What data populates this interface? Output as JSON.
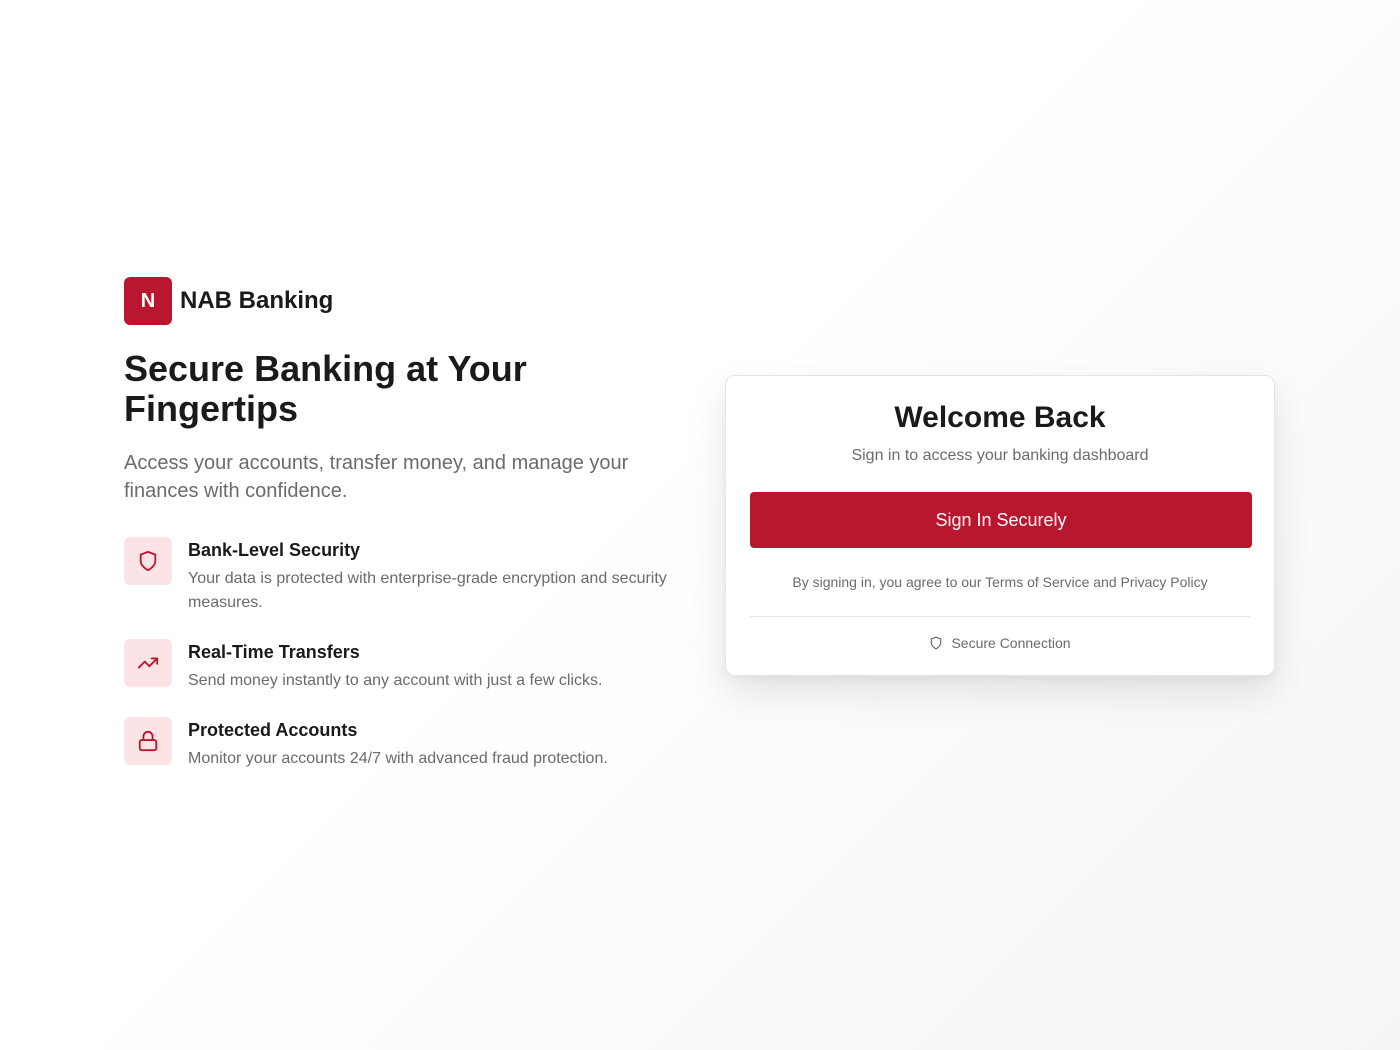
{
  "brand": {
    "logo_letter": "N",
    "name": "NAB Banking"
  },
  "hero": {
    "title": "Secure Banking at Your Fingertips",
    "subtitle": "Access your accounts, transfer money, and manage your finances with confidence."
  },
  "features": [
    {
      "icon": "shield-icon",
      "title": "Bank-Level Security",
      "description": "Your data is protected with enterprise-grade encryption and security measures."
    },
    {
      "icon": "trending-up-icon",
      "title": "Real-Time Transfers",
      "description": "Send money instantly to any account with just a few clicks."
    },
    {
      "icon": "lock-icon",
      "title": "Protected Accounts",
      "description": "Monitor your accounts 24/7 with advanced fraud protection."
    }
  ],
  "login_card": {
    "title": "Welcome Back",
    "subtitle": "Sign in to access your banking dashboard",
    "signin_label": "Sign In Securely",
    "terms_text": "By signing in, you agree to our Terms of Service and Privacy Policy",
    "secure_label": "Secure Connection",
    "secure_icon": "shield-icon"
  },
  "colors": {
    "brand": "#b8172f",
    "icon_bg": "#fbe3e6",
    "text_primary": "#1a1a1a",
    "text_muted": "#6b6b6b"
  }
}
